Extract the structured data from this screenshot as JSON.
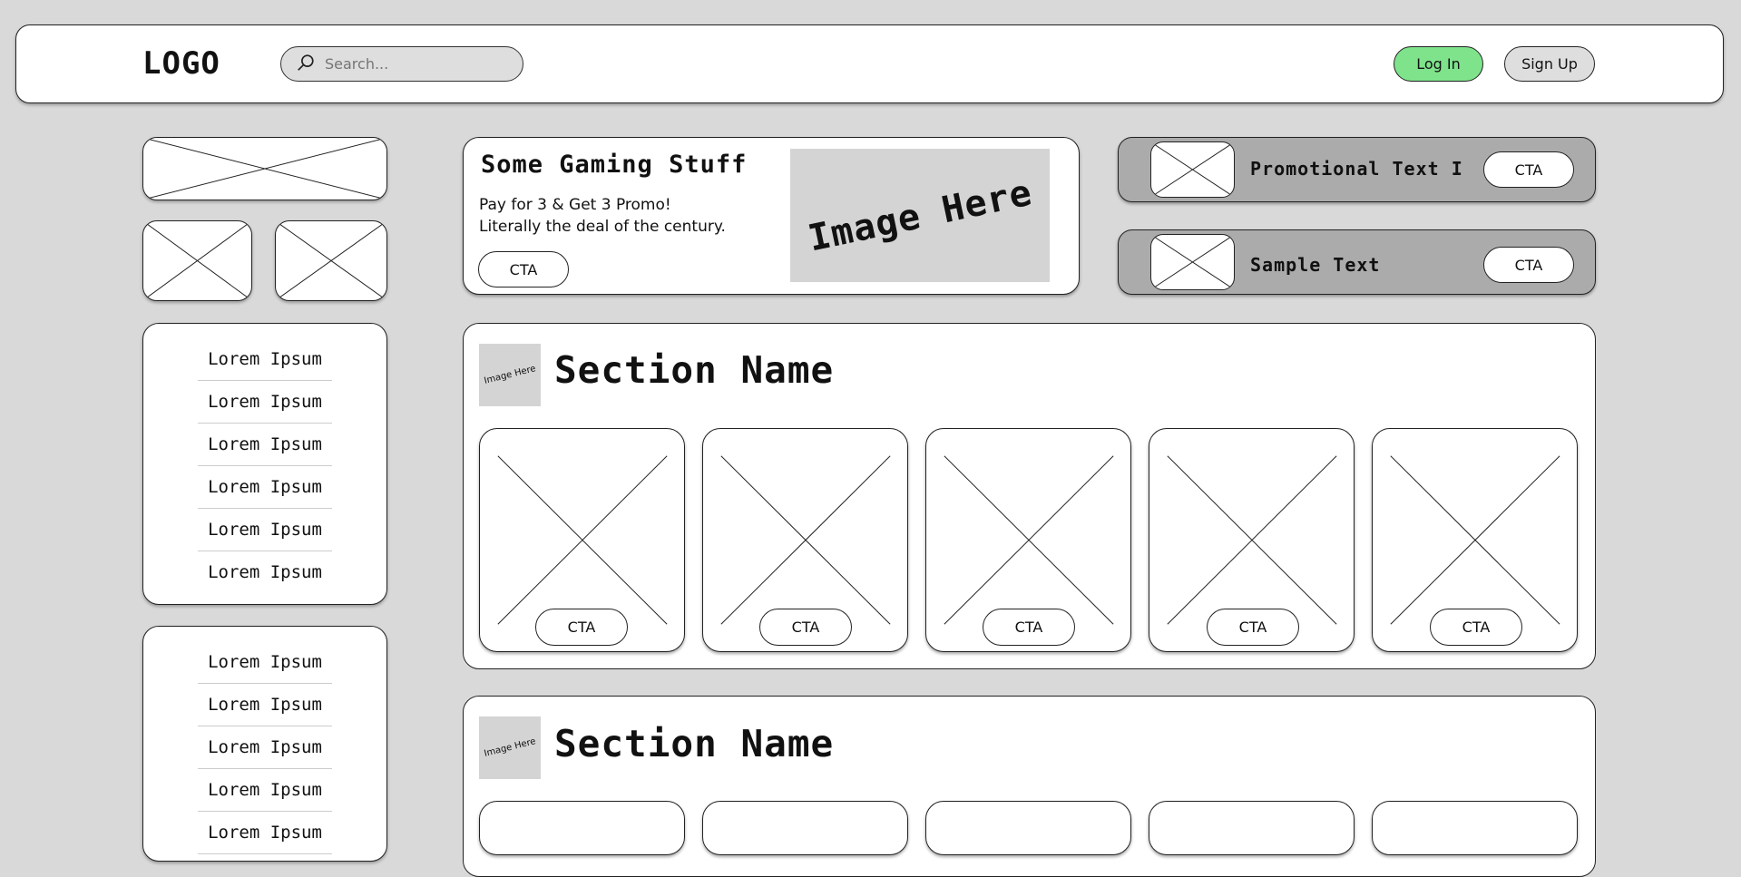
{
  "header": {
    "logo": "LOGO",
    "search_placeholder": "Search...",
    "login_label": "Log In",
    "signup_label": "Sign Up"
  },
  "sidebar": {
    "list1": [
      "Lorem Ipsum",
      "Lorem Ipsum",
      "Lorem Ipsum",
      "Lorem Ipsum",
      "Lorem Ipsum",
      "Lorem Ipsum"
    ],
    "list2": [
      "Lorem Ipsum",
      "Lorem Ipsum",
      "Lorem Ipsum",
      "Lorem Ipsum",
      "Lorem Ipsum"
    ]
  },
  "promo": {
    "title": "Some Gaming Stuff",
    "line1": "Pay for 3 & Get 3 Promo!",
    "line2": "Literally the deal of the century.",
    "cta": "CTA",
    "image_text": "Image Here"
  },
  "side_promos": [
    {
      "text": "Promotional Text I",
      "cta": "CTA"
    },
    {
      "text": "Sample Text",
      "cta": "CTA"
    }
  ],
  "sections": [
    {
      "icon_text": "Image Here",
      "title": "Section Name",
      "tiles": [
        "CTA",
        "CTA",
        "CTA",
        "CTA",
        "CTA"
      ]
    },
    {
      "icon_text": "Image Here",
      "title": "Section Name"
    }
  ],
  "colors": {
    "background": "#d9d9d9",
    "login_button": "#7fe38c",
    "side_promo_bg": "#ababab",
    "placeholder_gray": "#d4d4d4"
  }
}
